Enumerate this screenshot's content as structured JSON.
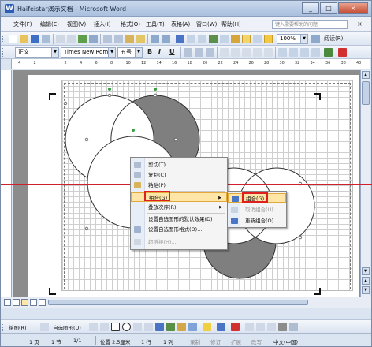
{
  "window": {
    "title": "Haifeistar演示文档 - Microsoft Word",
    "buttons": {
      "minimize": "_",
      "maximize": "□",
      "close": "×"
    }
  },
  "menubar": {
    "items": [
      "文件(F)",
      "编辑(E)",
      "视图(V)",
      "插入(I)",
      "格式(O)",
      "工具(T)",
      "表格(A)",
      "窗口(W)",
      "帮助(H)"
    ],
    "help_placeholder": "键入需要帮助的问题",
    "close": "×"
  },
  "toolbar_standard": {
    "zoom": "100%",
    "read_label": "阅读(R)"
  },
  "toolbar_format": {
    "style": "正文",
    "font": "Times New Roman",
    "size": "五号",
    "bold": "B",
    "italic": "I",
    "underline": "U"
  },
  "ruler": {
    "numbers": [
      "4",
      "2",
      "",
      "2",
      "4",
      "6",
      "8",
      "10",
      "12",
      "14",
      "16",
      "18",
      "20",
      "22",
      "24",
      "26",
      "28",
      "30",
      "32",
      "34",
      "36",
      "38",
      "40"
    ]
  },
  "context_menu": {
    "items": [
      {
        "label": "剪切(T)",
        "icon": "scissors-icon",
        "disabled": false
      },
      {
        "label": "复制(C)",
        "icon": "copy-icon",
        "disabled": false
      },
      {
        "label": "粘贴(P)",
        "icon": "paste-icon",
        "disabled": false
      },
      {
        "label": "组合(G)",
        "icon": "",
        "disabled": false,
        "submenu": true
      },
      {
        "label": "叠放次序(R)",
        "icon": "",
        "disabled": false,
        "submenu": true
      },
      {
        "label": "设置自选图形的默认效果(D)",
        "icon": "",
        "disabled": false
      },
      {
        "label": "设置自选图形格式(O)...",
        "icon": "format-shape-icon",
        "disabled": false
      },
      {
        "label": "超链接(H)...",
        "icon": "hyperlink-icon",
        "disabled": true
      }
    ]
  },
  "submenu": {
    "items": [
      {
        "label": "组合(G)",
        "disabled": false
      },
      {
        "label": "取消组合(U)",
        "disabled": true
      },
      {
        "label": "重新组合(O)",
        "disabled": false
      }
    ]
  },
  "drawbar": {
    "draw_label": "绘图(R)",
    "autoshapes_label": "自选图形(U)"
  },
  "statusbar": {
    "page": "1 页",
    "section": "1 节",
    "pages": "1/1",
    "position": "位置 2.5厘米",
    "line": "1 行",
    "column": "1 列",
    "rec": "录制",
    "track": "修订",
    "ext": "扩展",
    "ovr": "改写",
    "lang": "中文(中国)"
  },
  "colors": {
    "shape_fill_dark": "#7f7f7f",
    "highlight": "#ffe6a6",
    "annotation_red": "#e02020",
    "red_line": "#d0202c"
  }
}
